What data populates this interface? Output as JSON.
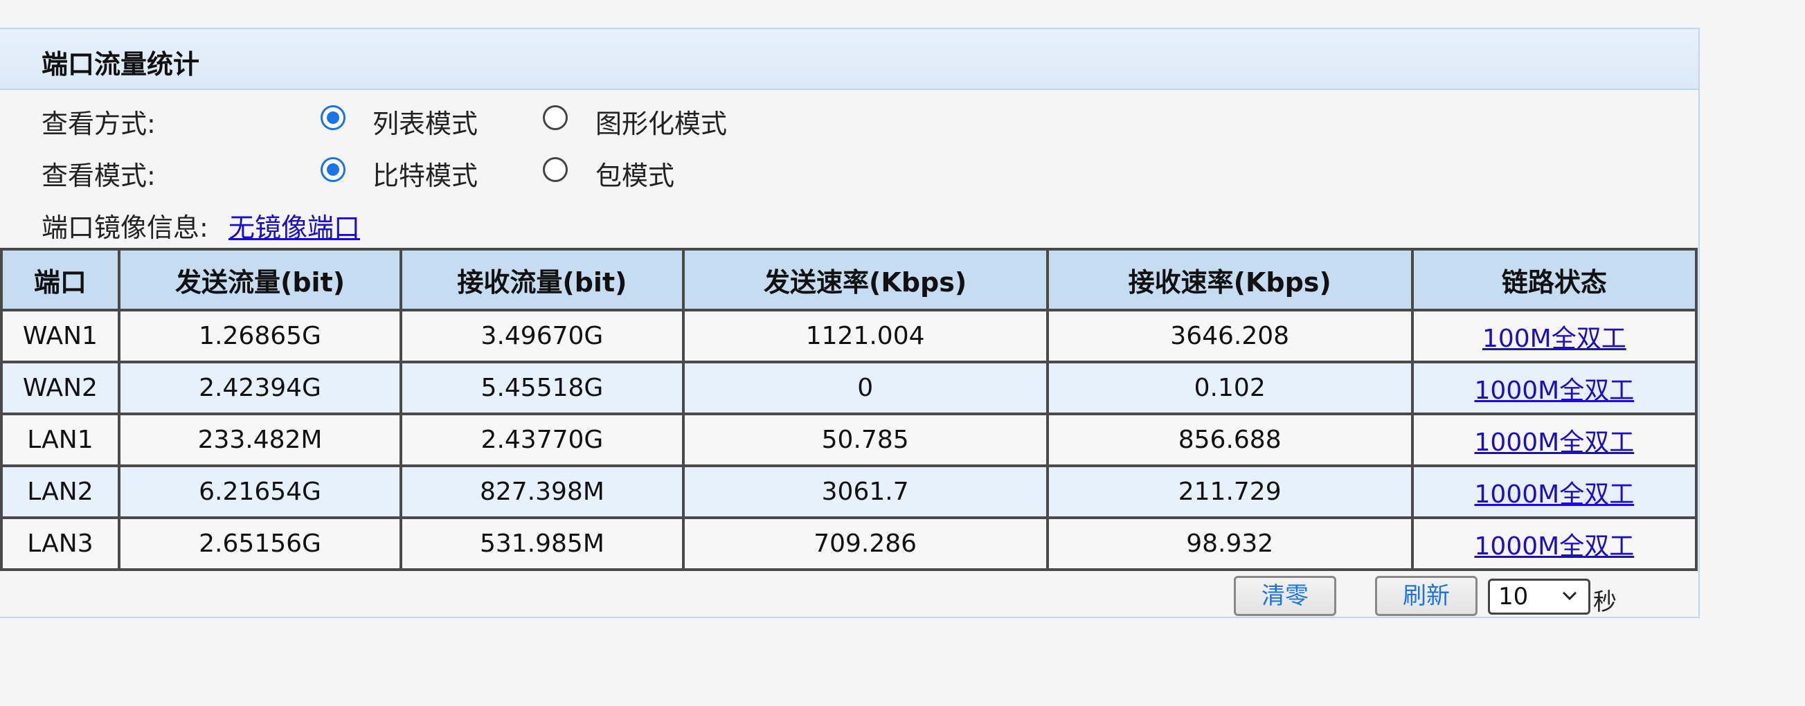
{
  "panel": {
    "title": "端口流量统计"
  },
  "view_style": {
    "label": "查看方式:",
    "options": [
      "列表模式",
      "图形化模式"
    ],
    "selected": "列表模式"
  },
  "view_mode": {
    "label": "查看模式:",
    "options": [
      "比特模式",
      "包模式"
    ],
    "selected": "比特模式"
  },
  "mirror": {
    "label": "端口镜像信息:",
    "link": "无镜像端口"
  },
  "table": {
    "headers": [
      "端口",
      "发送流量(bit)",
      "接收流量(bit)",
      "发送速率(Kbps)",
      "接收速率(Kbps)",
      "链路状态"
    ],
    "rows": [
      [
        "WAN1",
        "1.26865G",
        "3.49670G",
        "1121.004",
        "3646.208",
        "100M全双工"
      ],
      [
        "WAN2",
        "2.42394G",
        "5.45518G",
        "0",
        "0.102",
        "1000M全双工"
      ],
      [
        "LAN1",
        "233.482M",
        "2.43770G",
        "50.785",
        "856.688",
        "1000M全双工"
      ],
      [
        "LAN2",
        "6.21654G",
        "827.398M",
        "3061.7",
        "211.729",
        "1000M全双工"
      ],
      [
        "LAN3",
        "2.65156G",
        "531.985M",
        "709.286",
        "98.932",
        "1000M全双工"
      ]
    ]
  },
  "controls": {
    "clear_label": "清零",
    "refresh_label": "刷新",
    "interval_value": "10",
    "unit_label": "秒"
  },
  "colors": {
    "accent": "#1a73e8",
    "link": "#1a0dcc",
    "header_bg": "#c6dcf0"
  }
}
